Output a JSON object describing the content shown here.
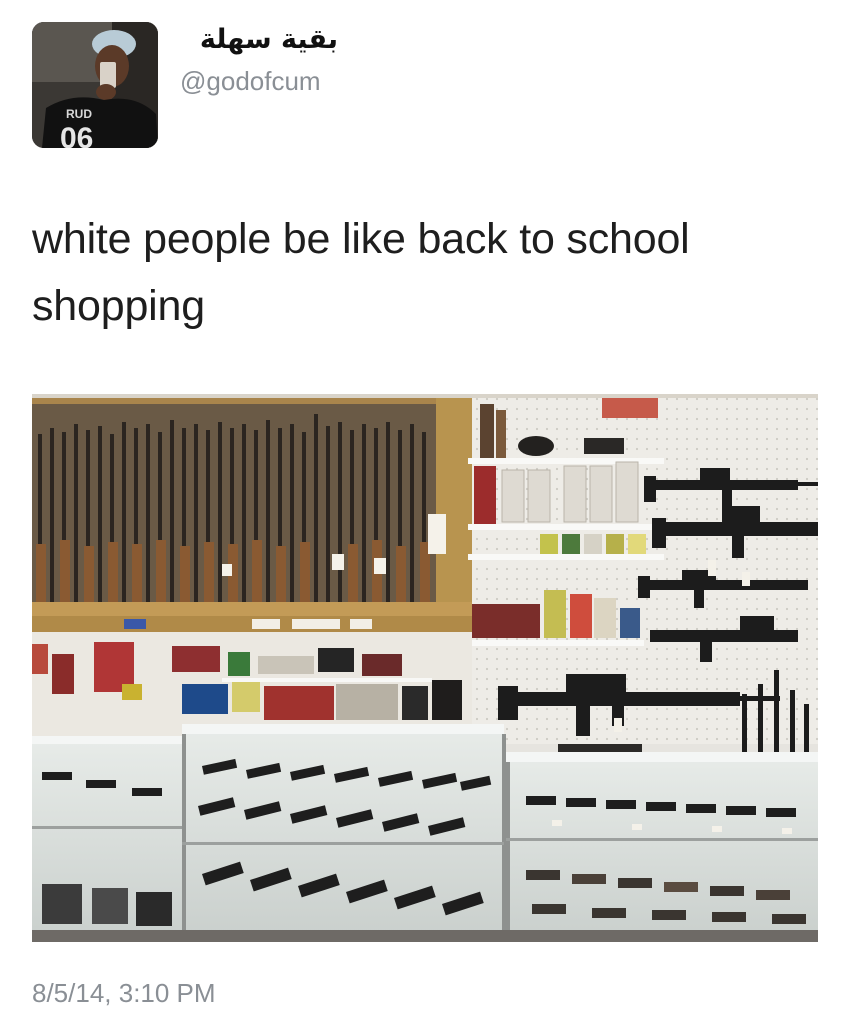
{
  "tweet": {
    "display_name": "بقية سهلة",
    "handle": "@godofcum",
    "text": "white people be like back to school shopping",
    "timestamp": "8/5/14, 3:10 PM",
    "avatar": {
      "shirt_text": "RUD",
      "shirt_number": "06"
    },
    "photo_subject": "gun-store-interior"
  }
}
